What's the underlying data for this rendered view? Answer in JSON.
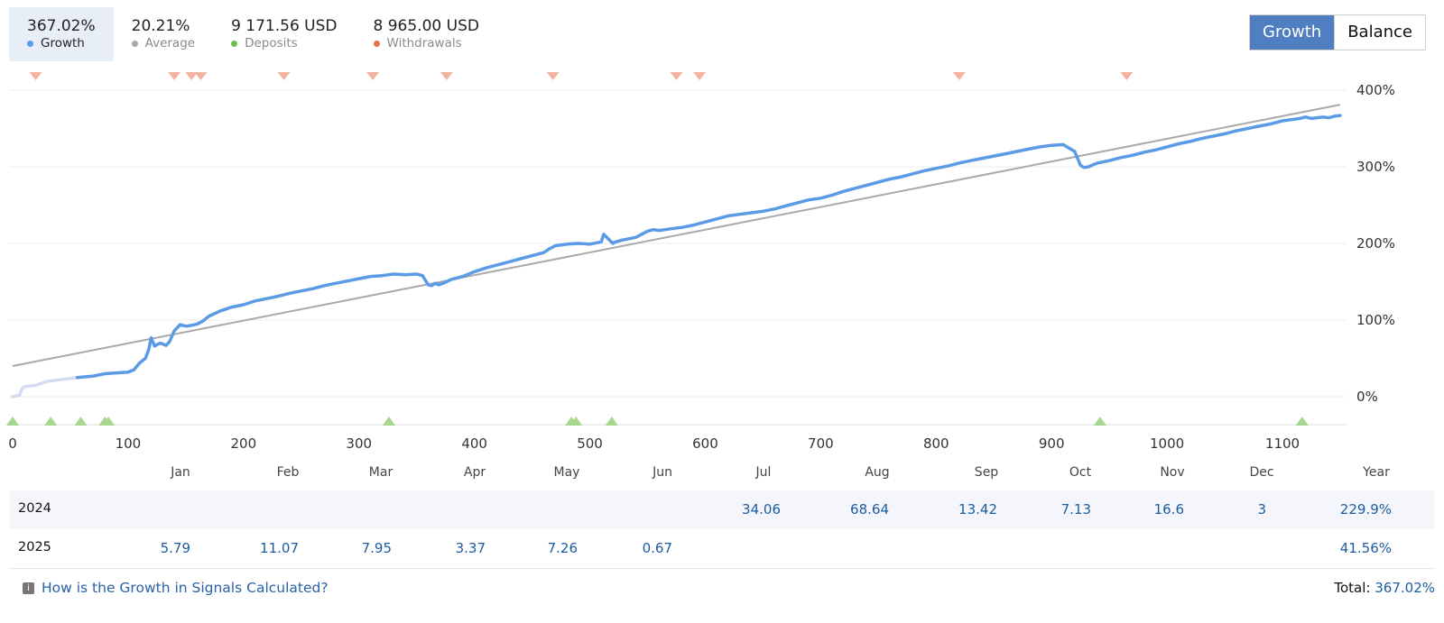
{
  "stats": [
    {
      "value": "367.02%",
      "label": "Growth",
      "color": "#5b9be6"
    },
    {
      "value": "20.21%",
      "label": "Average",
      "color": "#a9a9a9"
    },
    {
      "value": "9 171.56 USD",
      "label": "Deposits",
      "color": "#6cc04a"
    },
    {
      "value": "8 965.00 USD",
      "label": "Withdrawals",
      "color": "#e8704f"
    }
  ],
  "toggle": {
    "growth_label": "Growth",
    "balance_label": "Balance"
  },
  "chart_data": {
    "type": "line",
    "xlim": [
      0,
      1150
    ],
    "ylim": [
      -25,
      400
    ],
    "x_ticks": [
      0,
      100,
      200,
      300,
      400,
      500,
      600,
      700,
      800,
      900,
      1000,
      1100
    ],
    "x_tick_labels": [
      "0",
      "100",
      "200",
      "300",
      "400",
      "500",
      "600",
      "700",
      "800",
      "900",
      "1000",
      "1100"
    ],
    "y_ticks": [
      0,
      100,
      200,
      300,
      400
    ],
    "y_tick_labels": [
      "0%",
      "100%",
      "200%",
      "300%",
      "400%"
    ],
    "grid": true,
    "series": [
      {
        "key": "growth",
        "color": "#5b9be6",
        "faded_color": "#d4dcf4",
        "faded_until_x": 56,
        "x": [
          0,
          3,
          6,
          8,
          10,
          20,
          30,
          40,
          56,
          70,
          80,
          90,
          100,
          105,
          110,
          115,
          118,
          120,
          123,
          125,
          128,
          133,
          136,
          140,
          145,
          150,
          155,
          160,
          165,
          170,
          180,
          190,
          200,
          210,
          220,
          230,
          240,
          250,
          260,
          270,
          280,
          290,
          300,
          310,
          320,
          330,
          340,
          350,
          355,
          360,
          363,
          366,
          369,
          373,
          380,
          390,
          400,
          410,
          420,
          430,
          440,
          450,
          460,
          465,
          470,
          480,
          490,
          500,
          510,
          512,
          520,
          522,
          525,
          527,
          530,
          540,
          550,
          555,
          560,
          570,
          580,
          590,
          600,
          610,
          620,
          630,
          640,
          650,
          660,
          670,
          680,
          690,
          700,
          710,
          720,
          730,
          740,
          750,
          760,
          770,
          780,
          790,
          800,
          810,
          820,
          830,
          840,
          850,
          860,
          870,
          880,
          890,
          900,
          910,
          920,
          925,
          928,
          932,
          935,
          940,
          950,
          960,
          970,
          980,
          990,
          1000,
          1010,
          1020,
          1030,
          1040,
          1050,
          1060,
          1070,
          1080,
          1090,
          1100,
          1110,
          1115,
          1120,
          1125,
          1130,
          1135,
          1140,
          1145,
          1150
        ],
        "y": [
          0,
          1,
          2,
          10,
          13,
          15,
          20,
          22,
          25,
          27,
          30,
          31,
          32,
          35,
          44,
          50,
          62,
          77,
          66,
          68,
          70,
          67,
          72,
          86,
          94,
          92,
          93,
          95,
          99,
          105,
          112,
          117,
          120,
          125,
          128,
          131,
          135,
          138,
          141,
          145,
          148,
          151,
          154,
          157,
          158,
          160,
          159,
          160,
          158,
          146,
          145,
          148,
          146,
          148,
          153,
          157,
          163,
          168,
          172,
          176,
          180,
          184,
          188,
          193,
          197,
          199,
          200,
          199,
          202,
          212,
          200,
          202,
          203,
          204,
          205,
          208,
          216,
          218,
          217,
          219,
          221,
          224,
          228,
          232,
          236,
          238,
          240,
          242,
          245,
          249,
          253,
          257,
          259,
          263,
          268,
          272,
          276,
          280,
          284,
          287,
          291,
          295,
          298,
          301,
          305,
          308,
          311,
          314,
          317,
          320,
          323,
          326,
          328,
          329,
          320,
          302,
          299,
          300,
          302,
          305,
          308,
          312,
          315,
          319,
          322,
          326,
          330,
          333,
          337,
          340,
          343,
          347,
          350,
          353,
          356,
          360,
          362,
          363,
          365,
          363,
          364,
          365,
          364,
          366,
          367
        ]
      },
      {
        "key": "average",
        "color": "#a9a9a9",
        "x": [
          0,
          1150
        ],
        "y": [
          40,
          381
        ]
      }
    ],
    "withdrawal_markers_x": [
      20,
      140,
      155,
      163,
      235,
      312,
      376,
      468,
      575,
      595,
      820,
      965
    ],
    "deposit_markers_x": [
      0,
      33,
      59,
      80,
      83,
      326,
      484,
      488,
      519,
      942,
      1117
    ],
    "marker_colors": {
      "withdrawal": "#f4b3a0",
      "deposit": "#a7d68d"
    }
  },
  "months_header": [
    "Jan",
    "Feb",
    "Mar",
    "Apr",
    "May",
    "Jun",
    "Jul",
    "Aug",
    "Sep",
    "Oct",
    "Nov",
    "Dec",
    "Year"
  ],
  "rows": [
    {
      "year": "2024",
      "cells": [
        "",
        "",
        "",
        "",
        "",
        "",
        "34.06",
        "68.64",
        "13.42",
        "7.13",
        "16.6",
        "3",
        "229.9%"
      ]
    },
    {
      "year": "2025",
      "cells": [
        "5.79",
        "11.07",
        "7.95",
        "3.37",
        "7.26",
        "0.67",
        "",
        "",
        "",
        "",
        "",
        "",
        "41.56%"
      ]
    }
  ],
  "footer": {
    "help_icon": "info-icon",
    "help_text": "How is the Growth in Signals Calculated?",
    "total_label": "Total:",
    "total_value": "367.02%"
  }
}
